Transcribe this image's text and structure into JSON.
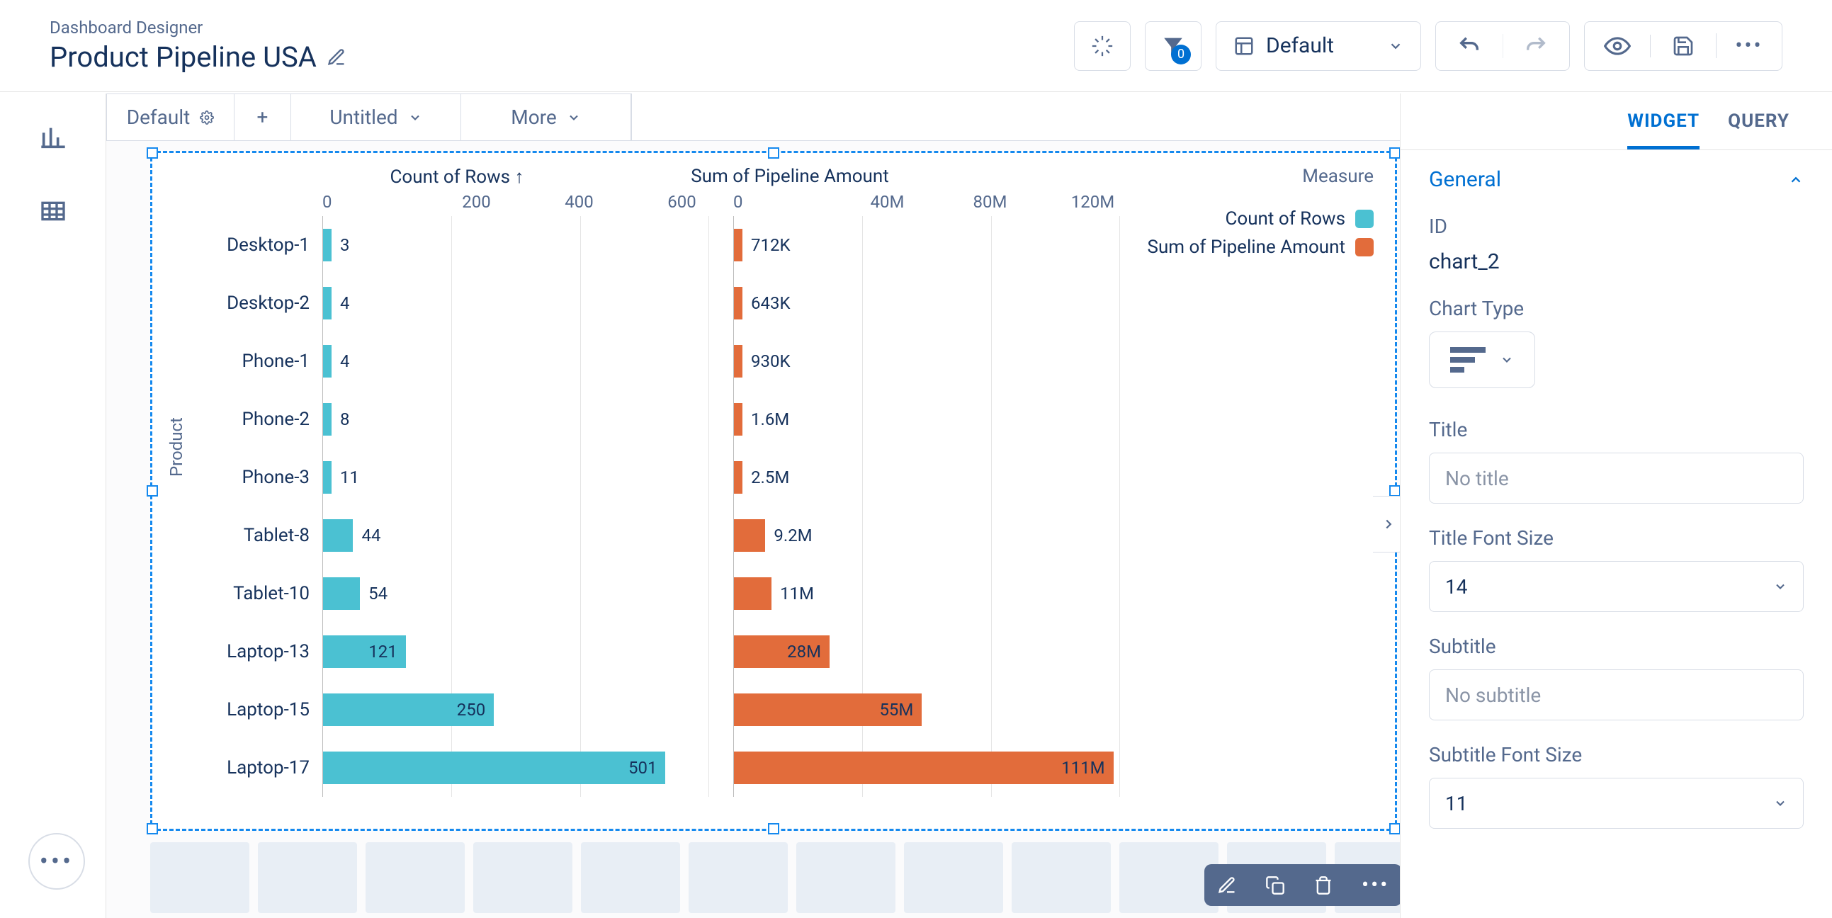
{
  "header": {
    "breadcrumb": "Dashboard Designer",
    "title": "Product Pipeline USA",
    "layout_selector": "Default",
    "funnel_badge": "0"
  },
  "tabs": {
    "default": "Default",
    "untitled": "Untitled",
    "more": "More"
  },
  "right_panel": {
    "tab_widget": "WIDGET",
    "tab_query": "QUERY",
    "section_general": "General",
    "id_label": "ID",
    "id_value": "chart_2",
    "chart_type_label": "Chart Type",
    "title_label": "Title",
    "title_placeholder": "No title",
    "title_font_label": "Title Font Size",
    "title_font_value": "14",
    "subtitle_label": "Subtitle",
    "subtitle_placeholder": "No subtitle",
    "subtitle_font_label": "Subtitle Font Size",
    "subtitle_font_value": "11"
  },
  "chart": {
    "measure_label": "Measure",
    "y_axis_label": "Product",
    "header_left": "Count of Rows ↑",
    "header_right": "Sum of Pipeline Amount",
    "legend_count": "Count of Rows",
    "legend_sum": "Sum of Pipeline Amount",
    "ticks_left": [
      "0",
      "200",
      "400",
      "600"
    ],
    "ticks_right": [
      "0",
      "40M",
      "80M",
      "120M"
    ]
  },
  "chart_data": {
    "type": "bar",
    "orientation": "horizontal",
    "y_axis_label": "Product",
    "categories": [
      "Desktop-1",
      "Desktop-2",
      "Phone-1",
      "Phone-2",
      "Phone-3",
      "Tablet-8",
      "Tablet-10",
      "Laptop-13",
      "Laptop-15",
      "Laptop-17"
    ],
    "series": [
      {
        "name": "Count of Rows",
        "color": "#4bc1d2",
        "xlim": [
          0,
          600
        ],
        "values": [
          3,
          4,
          4,
          8,
          11,
          44,
          54,
          121,
          250,
          501
        ],
        "labels": [
          "3",
          "4",
          "4",
          "8",
          "11",
          "44",
          "54",
          "121",
          "250",
          "501"
        ]
      },
      {
        "name": "Sum of Pipeline Amount",
        "color": "#e26c3b",
        "xlim": [
          0,
          120000000
        ],
        "values": [
          712000,
          643000,
          930000,
          1600000,
          2500000,
          9200000,
          11000000,
          28000000,
          55000000,
          111000000
        ],
        "labels": [
          "712K",
          "643K",
          "930K",
          "1.6M",
          "2.5M",
          "9.2M",
          "11M",
          "28M",
          "55M",
          "111M"
        ]
      }
    ]
  }
}
